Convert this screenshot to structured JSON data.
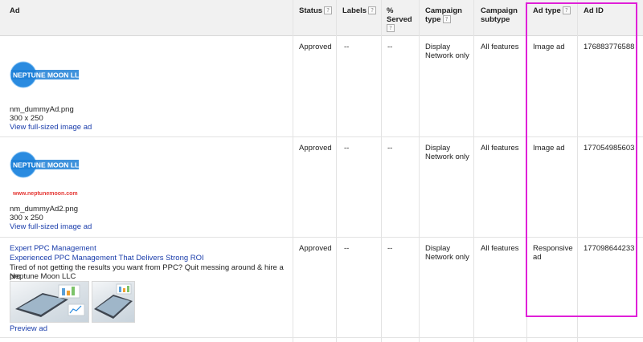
{
  "columns": {
    "ad": "Ad",
    "status": "Status",
    "labels": "Labels",
    "served": "% Served",
    "campaign_type": "Campaign type",
    "campaign_subtype": "Campaign subtype",
    "ad_type": "Ad type",
    "ad_id": "Ad ID",
    "help": "?"
  },
  "rows": [
    {
      "logo_text": "NEPTUNE MOON LLC",
      "filename": "nm_dummyAd.png",
      "size": "300 x 250",
      "link": "View full-sized image ad",
      "status": "Approved",
      "labels": "--",
      "served": "--",
      "campaign_type": "Display Network only",
      "campaign_subtype": "All features",
      "ad_type": "Image ad",
      "ad_id": "176883776588"
    },
    {
      "logo_text": "NEPTUNE MOON LLC",
      "logo_url": "www.neptunemoon.com",
      "filename": "nm_dummyAd2.png",
      "size": "300 x 250",
      "link": "View full-sized image ad",
      "status": "Approved",
      "labels": "--",
      "served": "--",
      "campaign_type": "Display Network only",
      "campaign_subtype": "All features",
      "ad_type": "Image ad",
      "ad_id": "177054985603"
    },
    {
      "headline1": "Expert PPC Management",
      "headline2": "Experienced PPC Management That Delivers Strong ROI",
      "description": "Tired of not getting the results you want from PPC? Quit messing around & hire a pro.",
      "business": "Neptune Moon LLC",
      "link": "Preview ad",
      "status": "Approved",
      "labels": "--",
      "served": "--",
      "campaign_type": "Display Network only",
      "campaign_subtype": "All features",
      "ad_type": "Responsive ad",
      "ad_id": "177098644233"
    }
  ],
  "colors": {
    "highlight": "#e020d8",
    "link": "#1a3dab",
    "logo_blue": "#1d7fd6",
    "url_red": "#e53935"
  }
}
